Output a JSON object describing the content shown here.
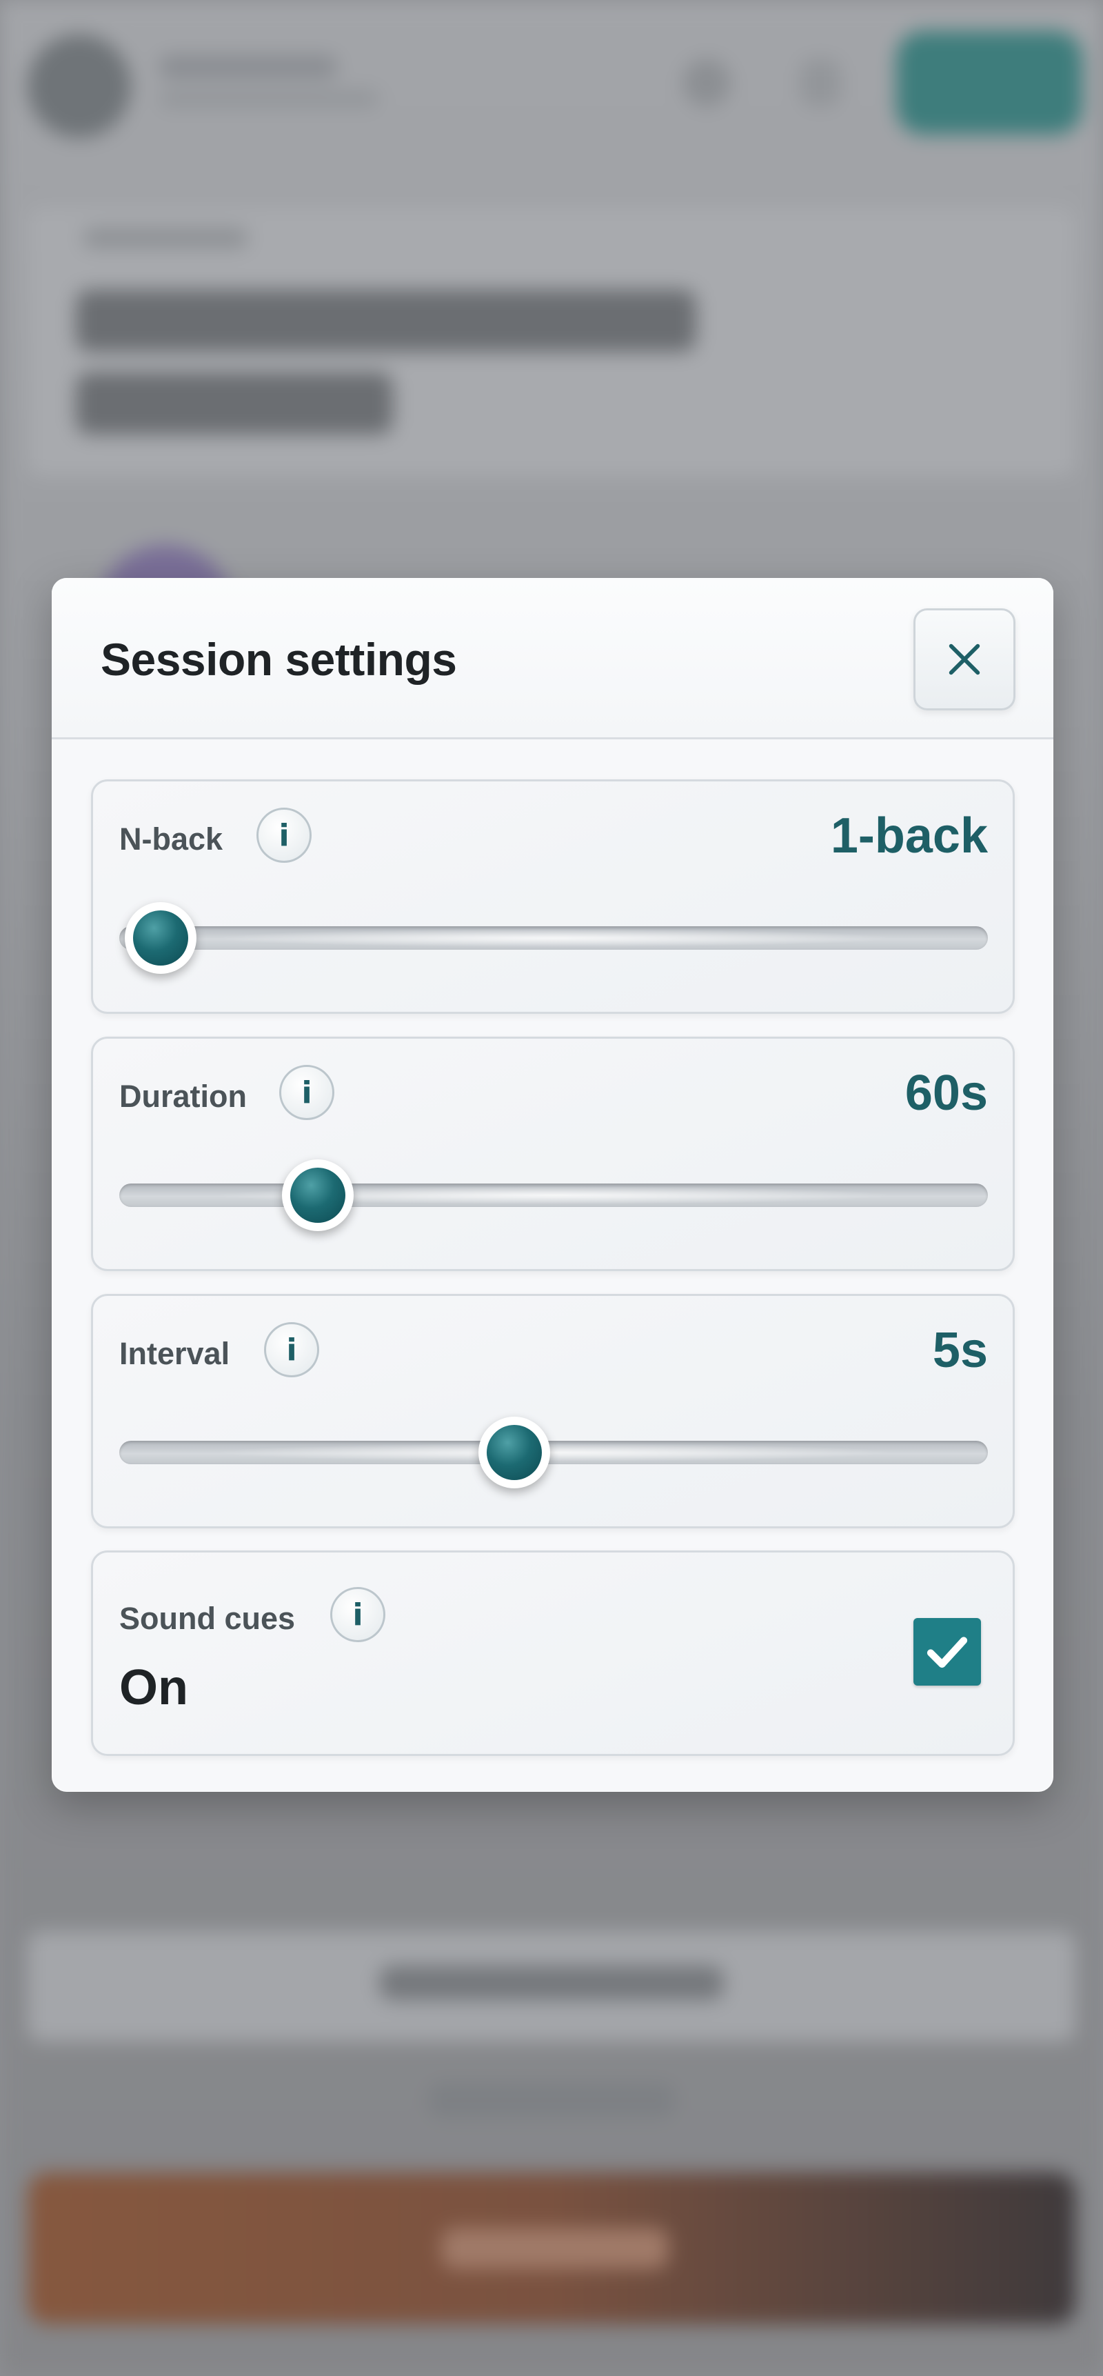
{
  "modal": {
    "title": "Session settings"
  },
  "settings": {
    "nback": {
      "label": "N-back",
      "value": "1-back",
      "level": 0.0
    },
    "duration": {
      "label": "Duration",
      "value": "60s",
      "level": 0.2
    },
    "interval": {
      "label": "Interval",
      "value": "5s",
      "level": 0.45
    },
    "sound": {
      "label": "Sound cues",
      "value": "On",
      "checked": true
    }
  },
  "icons": {
    "close": "close-icon",
    "info": "info-icon",
    "info_glyph": "i",
    "check": "checkmark-icon"
  },
  "colors": {
    "accent": "#1e5f66",
    "checkbox": "#1f7f87",
    "title": "#1f2326",
    "label": "#4b5358"
  }
}
